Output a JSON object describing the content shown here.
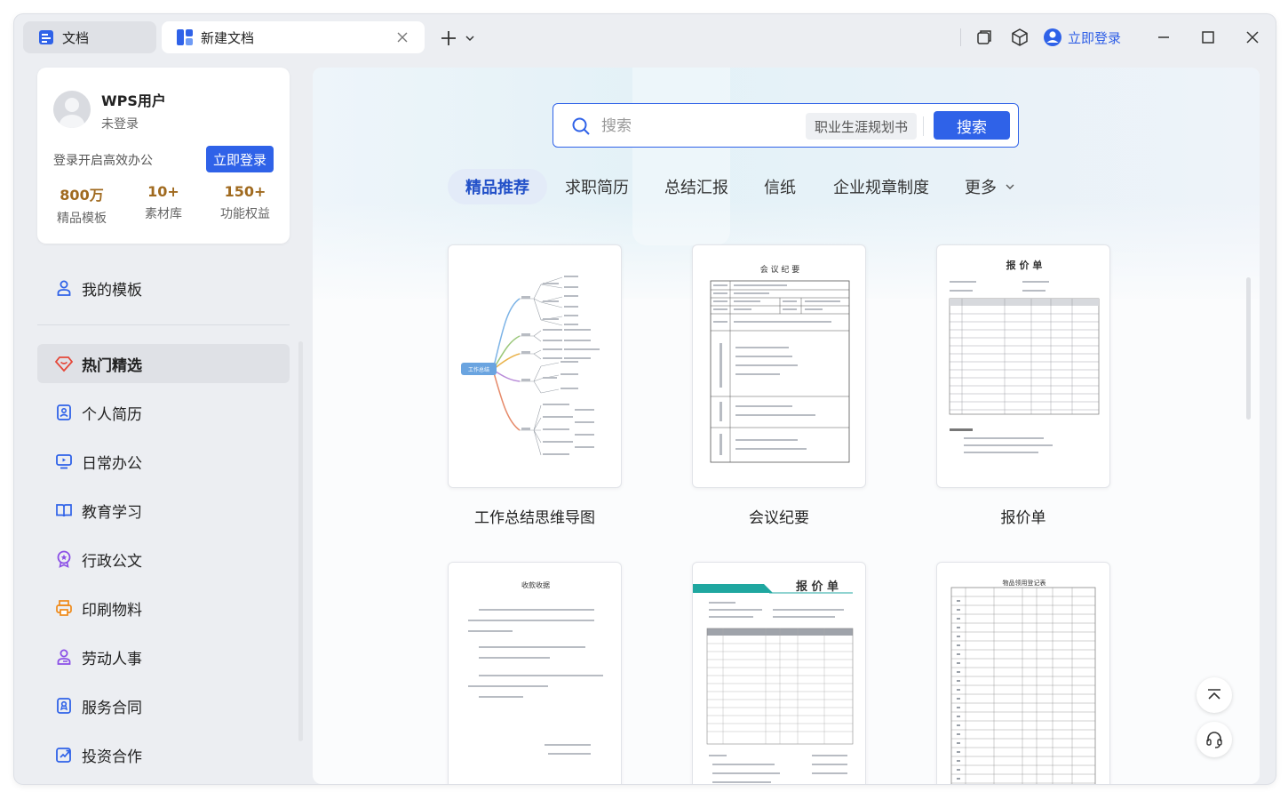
{
  "titlebar": {
    "tabs": [
      {
        "label": "文档"
      },
      {
        "label": "新建文档"
      }
    ],
    "login_label": "立即登录"
  },
  "user": {
    "name": "WPS用户",
    "status": "未登录",
    "prompt": "登录开启高效办公",
    "login_button": "立即登录",
    "stats": [
      {
        "value": "800万",
        "label": "精品模板"
      },
      {
        "value": "10+",
        "label": "素材库"
      },
      {
        "value": "150+",
        "label": "功能权益"
      }
    ]
  },
  "sidebar": {
    "my_templates": "我的模板",
    "items": [
      {
        "label": "热门精选",
        "icon": "heart-diamond-icon",
        "active": true
      },
      {
        "label": "个人简历",
        "icon": "resume-icon"
      },
      {
        "label": "日常办公",
        "icon": "monitor-icon"
      },
      {
        "label": "教育学习",
        "icon": "book-icon"
      },
      {
        "label": "行政公文",
        "icon": "badge-icon"
      },
      {
        "label": "印刷物料",
        "icon": "printer-icon"
      },
      {
        "label": "劳动人事",
        "icon": "person-icon"
      },
      {
        "label": "服务合同",
        "icon": "contract-icon"
      },
      {
        "label": "投资合作",
        "icon": "invest-icon"
      }
    ]
  },
  "search": {
    "placeholder": "搜索",
    "suggestion": "职业生涯规划书",
    "button": "搜索"
  },
  "categories": [
    "精品推荐",
    "求职简历",
    "总结汇报",
    "信纸",
    "企业规章制度",
    "更多"
  ],
  "templates": [
    {
      "title": "工作总结思维导图",
      "preview": {
        "center_label": "工作总结"
      }
    },
    {
      "title": "会议纪要",
      "preview": {
        "heading": "会 议 纪 要"
      }
    },
    {
      "title": "报价单",
      "preview": {
        "heading": "报 价 单"
      }
    },
    {
      "title": "",
      "preview": {
        "heading": "收款收据"
      }
    },
    {
      "title": "",
      "preview": {
        "heading": "报 价 单"
      }
    },
    {
      "title": "",
      "preview": {
        "heading": "物品领用登记表"
      }
    }
  ],
  "colors": {
    "accent": "#2f62e8",
    "stat_value": "#a06a1f",
    "icon_blue": "#2f62e8",
    "icon_red": "#e5483a",
    "icon_purple": "#8b4fe6",
    "icon_orange": "#ef8a1a"
  }
}
